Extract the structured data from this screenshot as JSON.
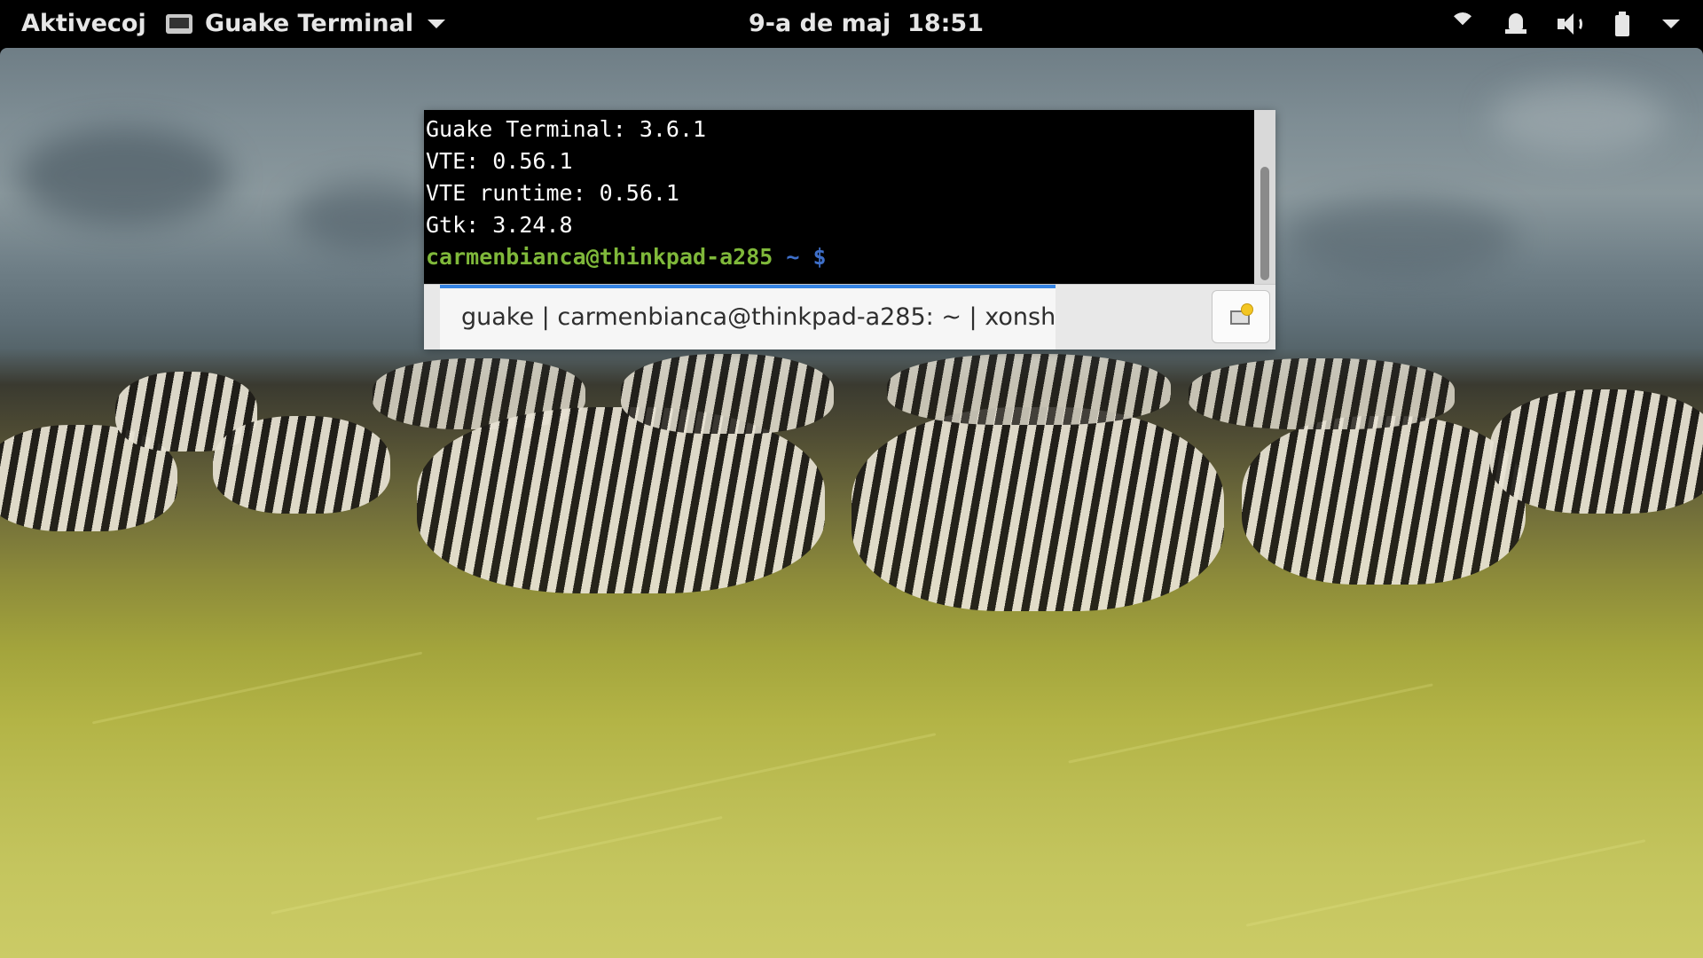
{
  "topbar": {
    "activities_label": "Aktivecoj",
    "app_name": "Guake Terminal",
    "clock": "9-a de maj  18:51",
    "tray_icons": [
      "wifi-icon",
      "notification-bell-icon",
      "volume-icon",
      "battery-icon",
      "system-menu-caret-icon"
    ]
  },
  "terminal": {
    "lines": [
      "Guake Terminal: 3.6.1",
      "VTE: 0.56.1",
      "VTE runtime: 0.56.1",
      "Gtk: 3.24.8"
    ],
    "prompt": {
      "user_host": "carmenbianca@thinkpad-a285",
      "cwd": " ~",
      "symbol": " $"
    }
  },
  "tabs": [
    {
      "label": "guake | carmenbianca@thinkpad-a285: ~ | xonsh",
      "active": true
    }
  ],
  "new_tab_button": {
    "icon": "new-tab-icon"
  },
  "colors": {
    "prompt_user": "#7fb83a",
    "prompt_path": "#3e6fc9",
    "tab_accent": "#3584e4",
    "terminal_bg": "#000000",
    "topbar_bg": "#000000"
  }
}
